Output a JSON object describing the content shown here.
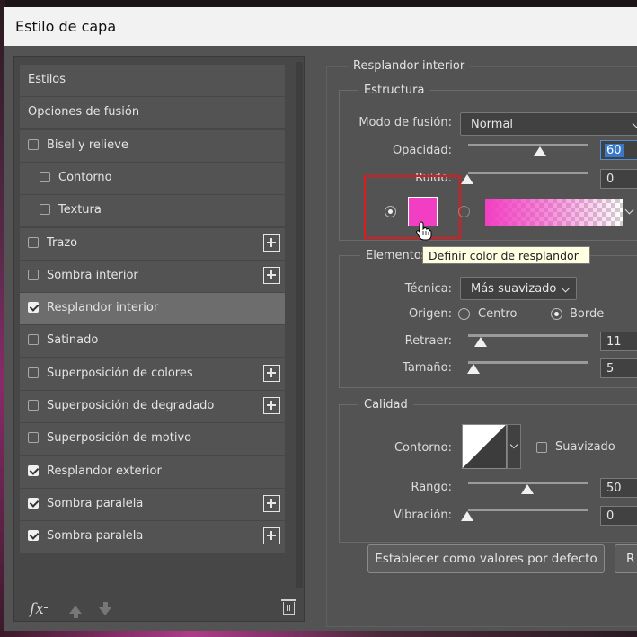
{
  "window": {
    "title": "Estilo de capa"
  },
  "styles_list": {
    "items": [
      {
        "label": "Estilos",
        "checkbox": false,
        "checked": false,
        "plus": false,
        "indent": 0,
        "selected": false
      },
      {
        "label": "Opciones de fusión",
        "checkbox": false,
        "checked": false,
        "plus": false,
        "indent": 0,
        "selected": false
      },
      {
        "label": "Bisel y relieve",
        "checkbox": true,
        "checked": false,
        "plus": false,
        "indent": 0,
        "selected": false
      },
      {
        "label": "Contorno",
        "checkbox": true,
        "checked": false,
        "plus": false,
        "indent": 1,
        "selected": false
      },
      {
        "label": "Textura",
        "checkbox": true,
        "checked": false,
        "plus": false,
        "indent": 1,
        "selected": false
      },
      {
        "label": "Trazo",
        "checkbox": true,
        "checked": false,
        "plus": true,
        "indent": 0,
        "selected": false
      },
      {
        "label": "Sombra interior",
        "checkbox": true,
        "checked": false,
        "plus": true,
        "indent": 0,
        "selected": false
      },
      {
        "label": "Resplandor interior",
        "checkbox": true,
        "checked": true,
        "plus": false,
        "indent": 0,
        "selected": true
      },
      {
        "label": "Satinado",
        "checkbox": true,
        "checked": false,
        "plus": false,
        "indent": 0,
        "selected": false
      },
      {
        "label": "Superposición de colores",
        "checkbox": true,
        "checked": false,
        "plus": true,
        "indent": 0,
        "selected": false
      },
      {
        "label": "Superposición de degradado",
        "checkbox": true,
        "checked": false,
        "plus": true,
        "indent": 0,
        "selected": false
      },
      {
        "label": "Superposición de motivo",
        "checkbox": true,
        "checked": false,
        "plus": false,
        "indent": 0,
        "selected": false
      },
      {
        "label": "Resplandor exterior",
        "checkbox": true,
        "checked": true,
        "plus": false,
        "indent": 0,
        "selected": false
      },
      {
        "label": "Sombra paralela",
        "checkbox": true,
        "checked": true,
        "plus": true,
        "indent": 0,
        "selected": false
      },
      {
        "label": "Sombra paralela",
        "checkbox": true,
        "checked": true,
        "plus": true,
        "indent": 0,
        "selected": false
      }
    ],
    "footer": {
      "fx_label": "fx"
    }
  },
  "panel": {
    "title": "Resplandor interior",
    "estructura": {
      "title": "Estructura",
      "blend_mode_label": "Modo de fusión:",
      "blend_mode_value": "Normal",
      "opacity_label": "Opacidad:",
      "opacity_value": "60",
      "opacity_fraction": 0.6,
      "noise_label": "Ruido:",
      "noise_value": "0",
      "noise_fraction": 0.0,
      "glow_color": "#f23ec2",
      "color_radio_selected": true
    },
    "tooltip": "Definir color de resplandor",
    "elementos": {
      "title": "Elementos",
      "technique_label": "Técnica:",
      "technique_value": "Más suavizado",
      "source_label": "Origen:",
      "source_center": "Centro",
      "source_edge": "Borde",
      "choke_label": "Retraer:",
      "choke_value": "11",
      "choke_fraction": 0.11,
      "size_label": "Tamaño:",
      "size_value": "5",
      "size_fraction": 0.02
    },
    "calidad": {
      "title": "Calidad",
      "contour_label": "Contorno:",
      "antialias_label": "Suavizado",
      "range_label": "Rango:",
      "range_value": "50",
      "range_fraction": 0.5,
      "jitter_label": "Vibración:",
      "jitter_value": "0",
      "jitter_fraction": 0.0
    },
    "buttons": {
      "set_default": "Establecer como valores por defecto",
      "reset_default_partial": "R"
    }
  },
  "colors": {
    "dialog_bg": "#535353",
    "selected_row": "#6d6d6d",
    "glow": "#f23ec2",
    "highlight_box": "#e0191f",
    "active_field": "#3a78c8"
  }
}
